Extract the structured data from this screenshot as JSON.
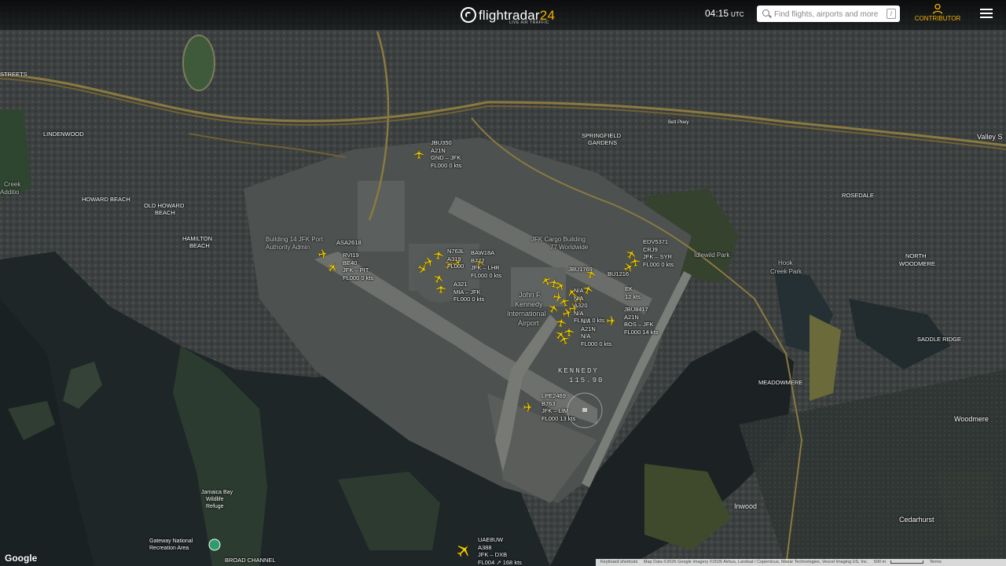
{
  "header": {
    "logo_main": "flightradar",
    "logo_num": "24",
    "logo_sub": "LIVE AIR TRAFFIC",
    "time": "04:15",
    "time_zone": "UTC",
    "search_placeholder": "Find flights, airports and more",
    "search_shortcut": "/",
    "contributor_label": "CONTRIBUTOR"
  },
  "map_labels": {
    "linden": "LINDENWOOD",
    "howard": "HOWARD BEACH",
    "old_howard": "OLD HOWARD",
    "old_howard2": "BEACH",
    "hamilton": "HAMILTON",
    "hamilton2": "BEACH",
    "springfield": "SPRINGFIELD",
    "springfield2": "GARDENS",
    "rosedale": "ROSEDALE",
    "north": "NORTH",
    "north2": "WOODMERE",
    "saddle": "SADDLE RIDGE",
    "meadowmere": "MEADOWMERE",
    "woodmere": "Woodmere",
    "inwood": "Inwood",
    "cedarhurst": "Cedarhurst",
    "valley": "Valley S",
    "belt": "Belt Pkwy",
    "gateway": "Gateway National",
    "gateway2": "Recreation Area",
    "jamaica": "Jamaica Bay",
    "jamaica2": "Wildlife",
    "jamaica3": "Refuge",
    "broad": "BROAD CHANNEL",
    "building14": "Building 14 JFK Port",
    "building14b": "Authority Admin",
    "cargo": "JFK Cargo Building",
    "cargo2": "77 Worldwide",
    "jfk": "John F.",
    "jfk2": "Kennedy",
    "jfk3": "International",
    "jfk4": "Airport",
    "idlewild": "Idlewild Park",
    "hook": "Hook",
    "hook2": "Creek Park",
    "streets": "STREETS",
    "creek": "Creek",
    "addition": "Additio"
  },
  "vor": {
    "name": "KENNEDY",
    "freq": "115.90"
  },
  "flights": [
    {
      "id": "jbu350",
      "text": "JBU350\nA21N\nGND – JFK\nFL000 0 kts"
    },
    {
      "id": "asa2618",
      "text": "ASA2618"
    },
    {
      "id": "rvi19",
      "text": "RVI19\nBE40\nJFK – PIT\nFL000 0 kts"
    },
    {
      "id": "n763l",
      "text": "N763L\nA319\nFL000"
    },
    {
      "id": "baw18a",
      "text": "BAW18A\nB772\nJFK – LHR\nFL000 0 kts"
    },
    {
      "id": "a321",
      "text": "A321\nMIA – JFK\nFL000 0 kts"
    },
    {
      "id": "jbu1769",
      "text": "JBU1769"
    },
    {
      "id": "bu1216",
      "text": "BU1216"
    },
    {
      "id": "edv5371",
      "text": "EDV5371\nCRJ9\nJFK – SYR\nFL000 0 kts"
    },
    {
      "id": "ek",
      "text": "EK\n12 kts"
    },
    {
      "id": "jbu8417",
      "text": "JBU8417\nA21N\nBOS – JFK\nFL000 14 kts"
    },
    {
      "id": "cluster1",
      "text": "N/A\nN/A\nA320\nN/A\nFL000 0 kts"
    },
    {
      "id": "cluster2",
      "text": "N/A\nA21N\nN/A\nFL000 0 kts"
    },
    {
      "id": "lpe2469",
      "text": "LPE2469\nB763\nJFK – LIM\nFL000 13 kts"
    },
    {
      "id": "uae8uw",
      "text": "UAE8UW\nA388\nJFK – DXB\nFL004 ↗ 168 kts"
    }
  ],
  "footer": {
    "google": "Google",
    "shortcuts": "Keyboard shortcuts",
    "map_data": "Map Data ©2026 Google Imagery ©2026 Airbus, Landsat / Copernicus, Maxar Technologies, Vexcel Imaging US, Inc.",
    "scale": "500 m",
    "terms": "Terms"
  },
  "colors": {
    "plane": "#f5d000",
    "accent": "#f5b400"
  }
}
